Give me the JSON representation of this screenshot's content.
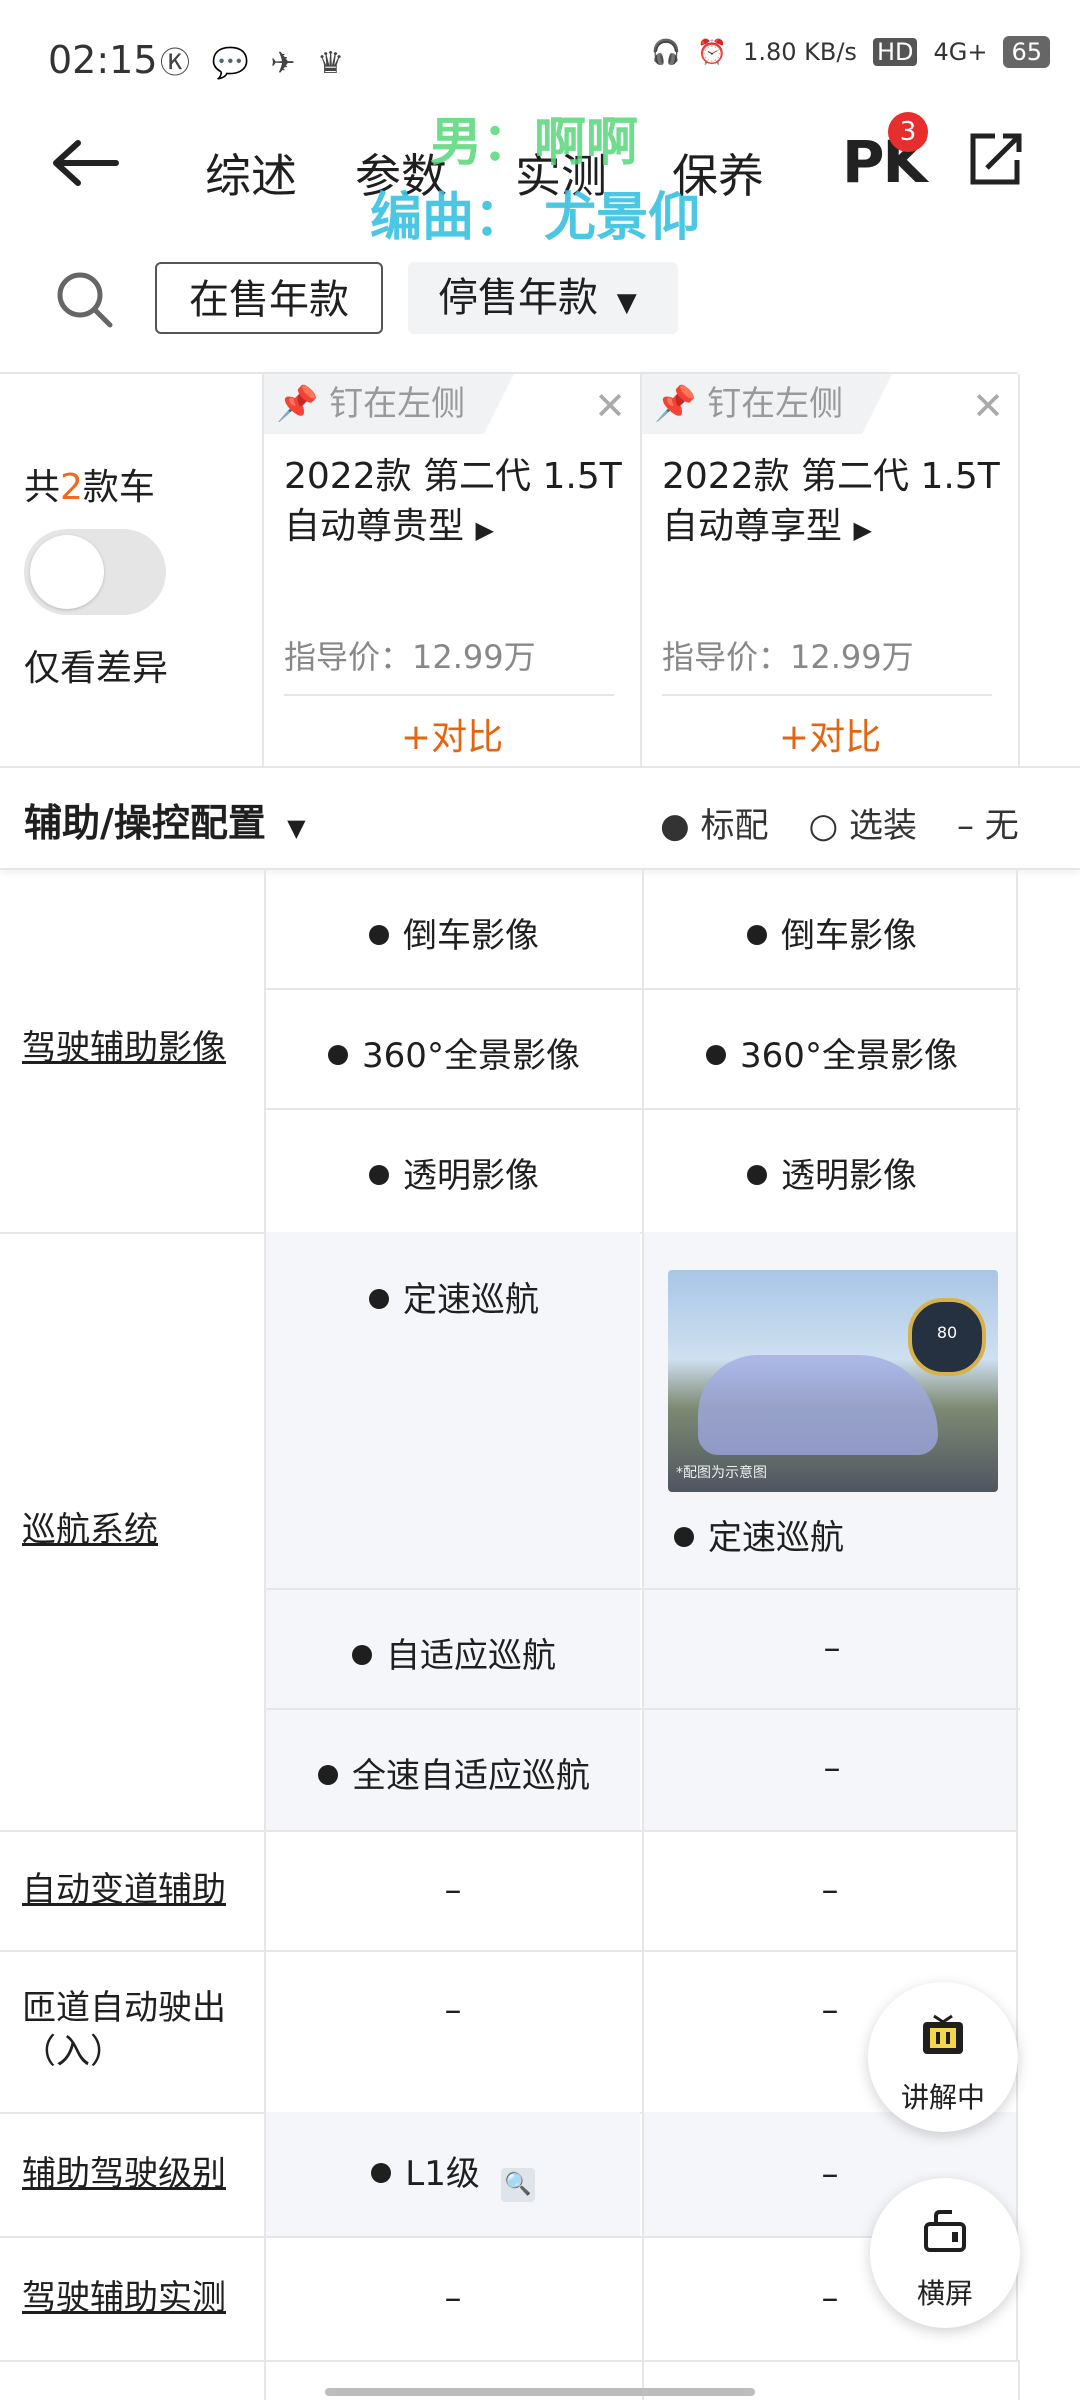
{
  "status": {
    "time": "02:15",
    "left_icons": "Ⓚ 💬 ✈ ♛",
    "net_speed": "1.80 KB/s",
    "hd": "HD",
    "network": "4G+",
    "battery": "65"
  },
  "nav": {
    "tabs": [
      "综述",
      "参数",
      "实测",
      "保养"
    ],
    "pk_label": "PK",
    "pk_badge": "3"
  },
  "overlay": {
    "line1": "男：啊啊",
    "line2": "编曲： 尤景仰"
  },
  "filters": {
    "on_sale": "在售年款",
    "stopped": "停售年款"
  },
  "compare": {
    "count_prefix": "共",
    "count": "2",
    "count_suffix": "款车",
    "diff_only": "仅看差异",
    "cars": [
      {
        "pin": "钉在左侧",
        "name": "2022款 第二代 1.5T 自动尊贵型",
        "price": "指导价：12.99万",
        "add": "+对比"
      },
      {
        "pin": "钉在左侧",
        "name": "2022款 第二代 1.5T 自动尊享型",
        "price": "指导价：12.99万",
        "add": "+对比"
      }
    ]
  },
  "section": {
    "title": "辅助/操控配置",
    "legend": {
      "standard": "标配",
      "optional": "选装",
      "none": "无"
    }
  },
  "rows": {
    "assist_image": {
      "label": "驾驶辅助影像",
      "c1": [
        "倒车影像",
        "360°全景影像",
        "透明影像"
      ],
      "c2": [
        "倒车影像",
        "360°全景影像",
        "透明影像"
      ]
    },
    "cruise": {
      "label": "巡航系统",
      "c1": [
        "定速巡航",
        "自适应巡航",
        "全速自适应巡航"
      ],
      "c2": [
        "定速巡航",
        "–",
        "–"
      ],
      "image_caption": "*配图为示意图",
      "gauge": "80"
    },
    "lane_change": {
      "label": "自动变道辅助",
      "c1": "–",
      "c2": "–"
    },
    "ramp": {
      "label": "匝道自动驶出（入）",
      "c1": "–",
      "c2": "–"
    },
    "level": {
      "label": "辅助驾驶级别",
      "c1": "L1级",
      "c2": "–"
    },
    "test": {
      "label": "驾驶辅助实测",
      "c1": "–",
      "c2": "–"
    }
  },
  "floating": {
    "explaining": "讲解中",
    "landscape": "横屏"
  }
}
